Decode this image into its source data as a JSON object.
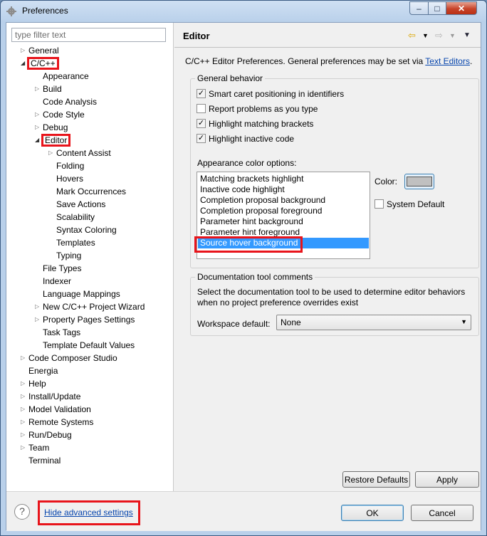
{
  "window": {
    "title": "Preferences"
  },
  "titlebar": {
    "min": "–",
    "max": "□",
    "close": "✕"
  },
  "filter": {
    "placeholder": "type filter text"
  },
  "tree": {
    "items": [
      {
        "label": "General",
        "arrow": "▷"
      },
      {
        "label": "C/C++",
        "arrow": "◢"
      },
      {
        "label": "Appearance",
        "arrow": ""
      },
      {
        "label": "Build",
        "arrow": "▷"
      },
      {
        "label": "Code Analysis",
        "arrow": ""
      },
      {
        "label": "Code Style",
        "arrow": "▷"
      },
      {
        "label": "Debug",
        "arrow": "▷"
      },
      {
        "label": "Editor",
        "arrow": "◢"
      },
      {
        "label": "Content Assist",
        "arrow": "▷"
      },
      {
        "label": "Folding",
        "arrow": ""
      },
      {
        "label": "Hovers",
        "arrow": ""
      },
      {
        "label": "Mark Occurrences",
        "arrow": ""
      },
      {
        "label": "Save Actions",
        "arrow": ""
      },
      {
        "label": "Scalability",
        "arrow": ""
      },
      {
        "label": "Syntax Coloring",
        "arrow": ""
      },
      {
        "label": "Templates",
        "arrow": ""
      },
      {
        "label": "Typing",
        "arrow": ""
      },
      {
        "label": "File Types",
        "arrow": ""
      },
      {
        "label": "Indexer",
        "arrow": ""
      },
      {
        "label": "Language Mappings",
        "arrow": ""
      },
      {
        "label": "New C/C++ Project Wizard",
        "arrow": "▷"
      },
      {
        "label": "Property Pages Settings",
        "arrow": "▷"
      },
      {
        "label": "Task Tags",
        "arrow": ""
      },
      {
        "label": "Template Default Values",
        "arrow": ""
      },
      {
        "label": "Code Composer Studio",
        "arrow": "▷"
      },
      {
        "label": "Energia",
        "arrow": ""
      },
      {
        "label": "Help",
        "arrow": "▷"
      },
      {
        "label": "Install/Update",
        "arrow": "▷"
      },
      {
        "label": "Model Validation",
        "arrow": "▷"
      },
      {
        "label": "Remote Systems",
        "arrow": "▷"
      },
      {
        "label": "Run/Debug",
        "arrow": "▷"
      },
      {
        "label": "Team",
        "arrow": "▷"
      },
      {
        "label": "Terminal",
        "arrow": ""
      }
    ]
  },
  "page": {
    "title": "Editor",
    "intro_text": "C/C++ Editor Preferences. General preferences may be set via ",
    "intro_link": "Text Editors",
    "intro_end": ".",
    "general_behavior": {
      "legend": "General behavior",
      "options": [
        {
          "label": "Smart caret positioning in identifiers",
          "mark": "✓"
        },
        {
          "label": "Report problems as you type",
          "mark": ""
        },
        {
          "label": "Highlight matching brackets",
          "mark": "✓"
        },
        {
          "label": "Highlight inactive code",
          "mark": "✓"
        }
      ],
      "color_options_label": "Appearance color options:",
      "color_items": [
        "Matching brackets highlight",
        "Inactive code highlight",
        "Completion proposal background",
        "Completion proposal foreground",
        "Parameter hint background",
        "Parameter hint foreground",
        "Source hover background"
      ],
      "selected_color_item": "Source hover background",
      "color_label": "Color:",
      "color_value": "#c0c0c0",
      "system_default": "System Default"
    },
    "documentation": {
      "legend": "Documentation tool comments",
      "description": "Select the documentation tool to be used to determine editor behaviors when no project preference overrides exist",
      "workspace_label": "Workspace default:",
      "workspace_value": "None"
    },
    "restore_defaults": "Restore Defaults",
    "apply": "Apply"
  },
  "footer": {
    "help": "?",
    "hide_advanced": "Hide advanced settings",
    "ok": "OK",
    "cancel": "Cancel"
  },
  "colors": {
    "highlight_box": "#e8141b",
    "selection": "#3399ff",
    "link": "#0645ad"
  }
}
